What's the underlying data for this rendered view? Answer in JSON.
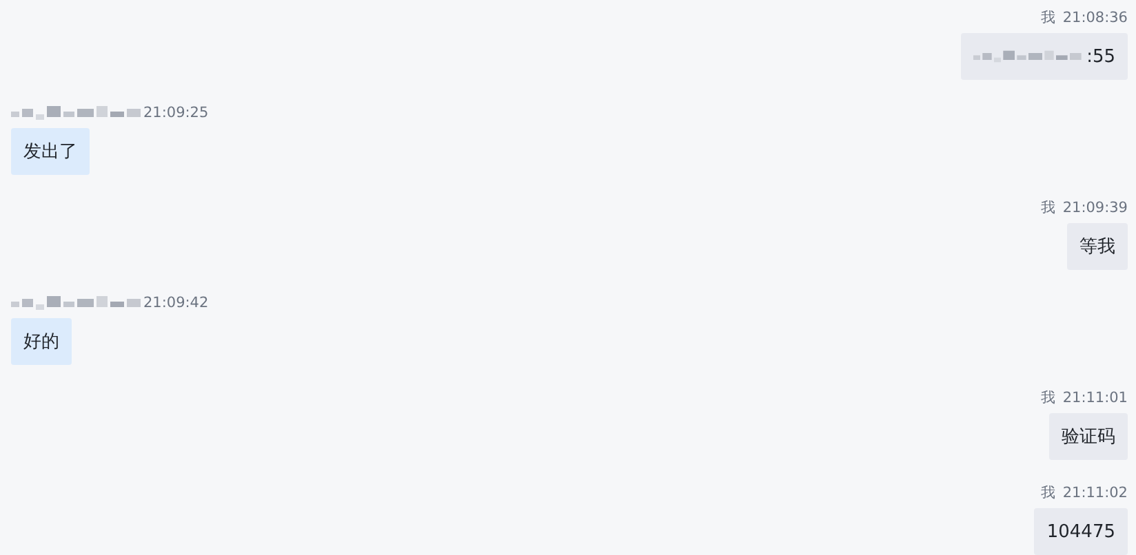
{
  "messages": [
    {
      "kind": "me",
      "sender": "我",
      "time": "21:08:36",
      "text": ":55",
      "blurred_prefix": true
    },
    {
      "kind": "other",
      "time": "21:09:25",
      "text": "发出了",
      "blurred_prefix": false
    },
    {
      "kind": "me",
      "sender": "我",
      "time": "21:09:39",
      "text": "等我",
      "blurred_prefix": false
    },
    {
      "kind": "other",
      "time": "21:09:42",
      "text": "好的",
      "blurred_prefix": false
    },
    {
      "kind": "me",
      "sender": "我",
      "time": "21:11:01",
      "text": "验证码",
      "blurred_prefix": false
    },
    {
      "kind": "me",
      "sender": "我",
      "time": "21:11:02",
      "text": "104475",
      "blurred_prefix": false
    }
  ]
}
